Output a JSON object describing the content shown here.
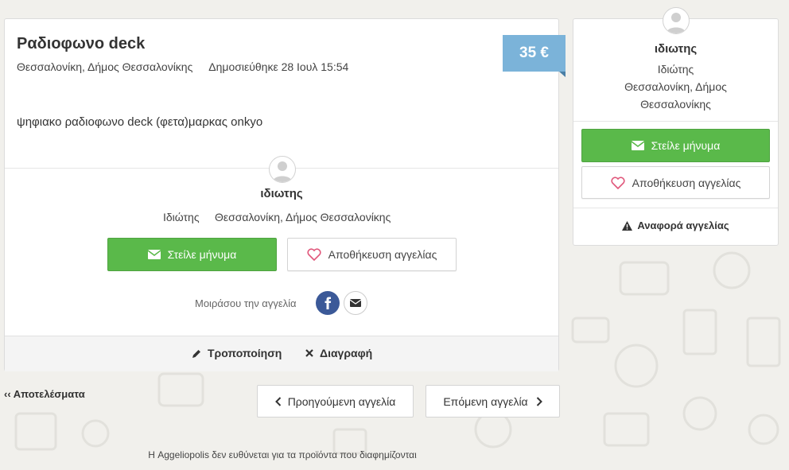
{
  "listing": {
    "title": "Ραδιοφωνο deck",
    "location": "Θεσσαλονίκη, Δήμος Θεσσαλονίκης",
    "published": "Δημοσιεύθηκε 28 Ιουλ 15:54",
    "price": "35 €",
    "description": "ψηφιακο ραδιοφωνο deck (φετα)μαρκας onkyo"
  },
  "seller": {
    "name": "ιδιωτης",
    "type": "Ιδιώτης",
    "location": "Θεσσαλονίκη, Δήμος Θεσσαλονίκης",
    "side_location_line1": "Θεσσαλονίκη, Δήμος",
    "side_location_line2": "Θεσσαλονίκης"
  },
  "actions": {
    "send_message": "Στείλε μήνυμα",
    "save_ad": "Αποθήκευση αγγελίας",
    "share_label": "Μοιράσου την αγγελία",
    "edit": "Τροποποίηση",
    "delete": "Διαγραφή",
    "report": "Αναφορά αγγελίας"
  },
  "navigation": {
    "back": "‹‹ Αποτελέσματα",
    "previous": "Προηγούμενη αγγελία",
    "next": "Επόμενη αγγελία"
  },
  "footer": {
    "disclaimer": "Η Aggeliopolis δεν ευθύνεται για τα προϊόντα που διαφημίζονται"
  },
  "icons": {
    "avatar": "avatar-icon",
    "envelope": "envelope-icon",
    "heart": "heart-icon",
    "facebook": "facebook-icon",
    "email": "email-icon",
    "pencil": "pencil-icon",
    "close": "close-icon",
    "warning": "warning-icon",
    "chevron_left": "chevron-left-icon",
    "chevron_right": "chevron-right-icon"
  },
  "colors": {
    "price_bg": "#7bb3d9",
    "primary_button": "#5ab94a",
    "facebook": "#3b5998",
    "heart": "#e0567a"
  }
}
